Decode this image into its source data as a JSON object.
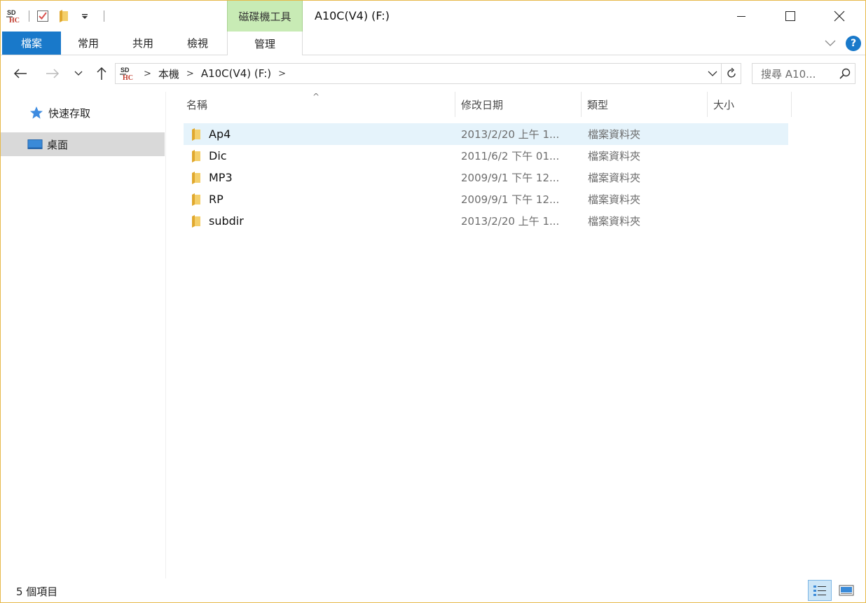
{
  "titlebar": {
    "app_icon": "sd-card-icon",
    "qat_items": [
      "properties-check-icon",
      "new-folder-icon",
      "customize-qat-dropdown-icon"
    ],
    "context_group_label": "磁碟機工具",
    "window_title": "A10C(V4) (F:)",
    "buttons": [
      "minimize-icon",
      "maximize-icon",
      "close-icon"
    ]
  },
  "ribbon": {
    "tabs": {
      "file": "檔案",
      "home": "常用",
      "share": "共用",
      "view": "檢視",
      "manage": "管理"
    },
    "active_tab": "檔案",
    "accent_color": "#1979ca",
    "context_color": "#c8ebb5"
  },
  "navbar": {
    "breadcrumb": [
      "本機",
      "A10C(V4) (F:)"
    ],
    "search_placeholder": "搜尋 A10..."
  },
  "sidebar": {
    "items": [
      {
        "label": "快速存取",
        "icon": "star-icon"
      },
      {
        "label": "桌面",
        "icon": "desktop-icon",
        "selected": true
      }
    ]
  },
  "columns": {
    "name": "名稱",
    "date": "修改日期",
    "type": "類型",
    "size": "大小"
  },
  "files": [
    {
      "name": "Ap4",
      "date": "2013/2/20 上午 1...",
      "type": "檔案資料夾",
      "selected": true
    },
    {
      "name": "Dic",
      "date": "2011/6/2 下午 01...",
      "type": "檔案資料夾"
    },
    {
      "name": "MP3",
      "date": "2009/9/1 下午 12...",
      "type": "檔案資料夾"
    },
    {
      "name": "RP",
      "date": "2009/9/1 下午 12...",
      "type": "檔案資料夾"
    },
    {
      "name": "subdir",
      "date": "2013/2/20 上午 1...",
      "type": "檔案資料夾"
    }
  ],
  "statusbar": {
    "item_count": "5 個項目",
    "views": [
      "details-view-icon",
      "large-icons-view-icon"
    ],
    "active_view": "details-view-icon"
  }
}
